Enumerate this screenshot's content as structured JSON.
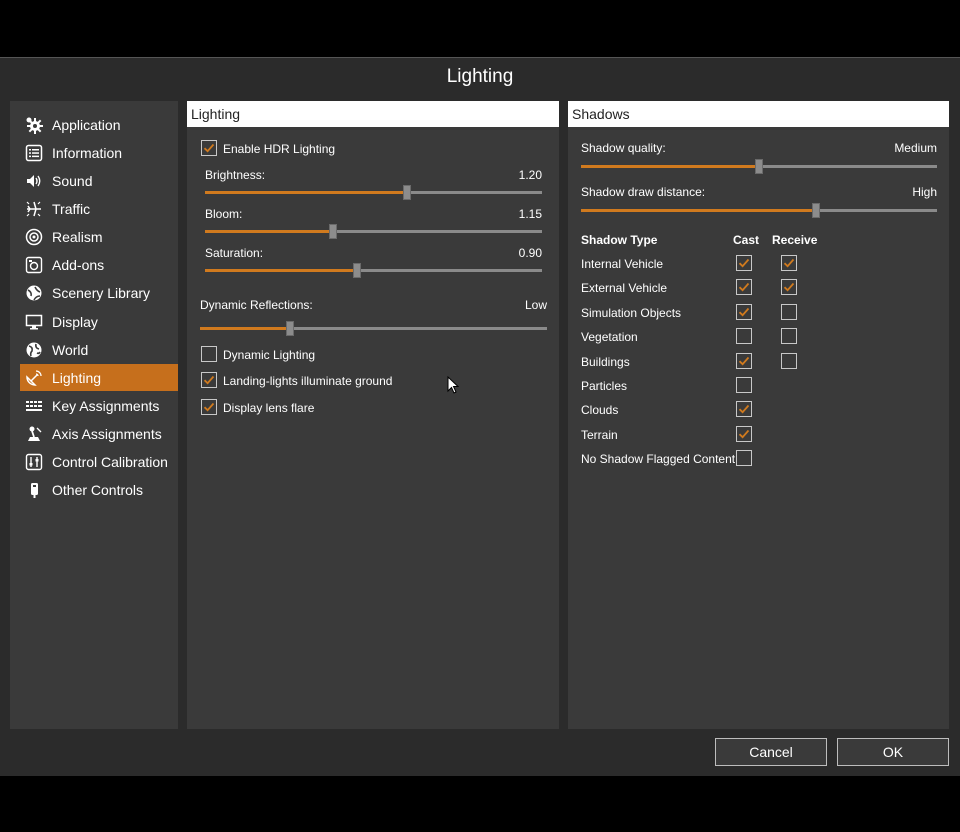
{
  "dialog": {
    "title": "Lighting"
  },
  "sidebar": {
    "items": [
      {
        "label": "Application",
        "icon": "gear-icon"
      },
      {
        "label": "Information",
        "icon": "list-icon"
      },
      {
        "label": "Sound",
        "icon": "speaker-icon"
      },
      {
        "label": "Traffic",
        "icon": "airplane-icon"
      },
      {
        "label": "Realism",
        "icon": "target-icon"
      },
      {
        "label": "Add-ons",
        "icon": "addon-icon"
      },
      {
        "label": "Scenery Library",
        "icon": "globe-map-icon"
      },
      {
        "label": "Display",
        "icon": "monitor-icon"
      },
      {
        "label": "World",
        "icon": "world-icon"
      },
      {
        "label": "Lighting",
        "icon": "satellite-dish-icon",
        "active": true
      },
      {
        "label": "Key Assignments",
        "icon": "keyboard-icon"
      },
      {
        "label": "Axis Assignments",
        "icon": "joystick-icon"
      },
      {
        "label": "Control Calibration",
        "icon": "sliders-icon"
      },
      {
        "label": "Other Controls",
        "icon": "controller-icon"
      }
    ]
  },
  "lighting": {
    "header": "Lighting",
    "hdr_label": "Enable HDR Lighting",
    "hdr_checked": true,
    "brightness_label": "Brightness:",
    "brightness_value": "1.20",
    "brightness_fraction": 0.6,
    "bloom_label": "Bloom:",
    "bloom_value": "1.15",
    "bloom_fraction": 0.38,
    "saturation_label": "Saturation:",
    "saturation_value": "0.90",
    "saturation_fraction": 0.45,
    "reflections_label": "Dynamic Reflections:",
    "reflections_value": "Low",
    "reflections_fraction": 0.26,
    "dynamic_lighting_label": "Dynamic Lighting",
    "dynamic_lighting_checked": false,
    "landing_lights_label": "Landing-lights illuminate ground",
    "landing_lights_checked": true,
    "lens_flare_label": "Display lens flare",
    "lens_flare_checked": true
  },
  "shadows": {
    "header": "Shadows",
    "quality_label": "Shadow quality:",
    "quality_value": "Medium",
    "quality_fraction": 0.5,
    "distance_label": "Shadow draw distance:",
    "distance_value": "High",
    "distance_fraction": 0.66,
    "col_type": "Shadow Type",
    "col_cast": "Cast",
    "col_receive": "Receive",
    "rows": [
      {
        "label": "Internal Vehicle",
        "cast": true,
        "receive": true
      },
      {
        "label": "External Vehicle",
        "cast": true,
        "receive": true
      },
      {
        "label": "Simulation Objects",
        "cast": true,
        "receive": false
      },
      {
        "label": "Vegetation",
        "cast": false,
        "receive": false
      },
      {
        "label": "Buildings",
        "cast": true,
        "receive": false
      },
      {
        "label": "Particles",
        "cast": false,
        "receive": null
      },
      {
        "label": "Clouds",
        "cast": true,
        "receive": null
      },
      {
        "label": "Terrain",
        "cast": true,
        "receive": null
      },
      {
        "label": "No Shadow Flagged Content",
        "cast": false,
        "receive": null
      }
    ]
  },
  "buttons": {
    "cancel": "Cancel",
    "ok": "OK"
  },
  "colors": {
    "accent": "#c66f1c",
    "panel": "#3a3a3a",
    "background": "#2b2b2b"
  }
}
